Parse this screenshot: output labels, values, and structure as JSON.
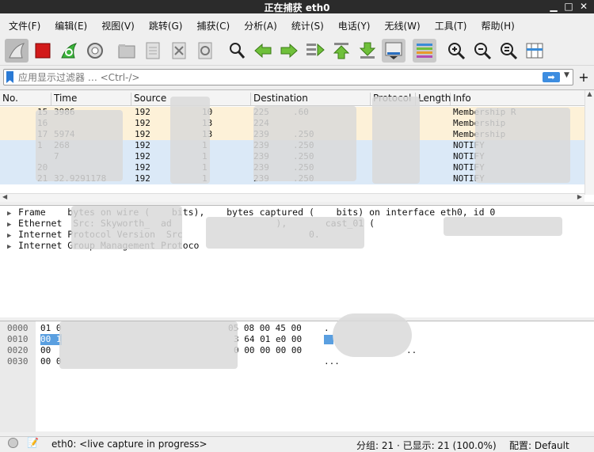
{
  "window": {
    "title": "正在捕获 eth0",
    "min_icon": "minimize-icon",
    "max_icon": "maximize-icon",
    "close_icon": "close-icon"
  },
  "menu": [
    "文件(F)",
    "编辑(E)",
    "视图(V)",
    "跳转(G)",
    "捕获(C)",
    "分析(A)",
    "统计(S)",
    "电话(Y)",
    "无线(W)",
    "工具(T)",
    "帮助(H)"
  ],
  "toolbar": [
    "shark-fin-start-icon",
    "stop-capture-icon",
    "restart-capture-icon",
    "capture-options-icon",
    "open-file-icon",
    "save-file-icon",
    "close-file-icon",
    "reload-file-icon",
    "find-packet-icon",
    "go-back-icon",
    "go-forward-icon",
    "go-to-packet-icon",
    "go-first-icon",
    "go-last-icon",
    "auto-scroll-icon",
    "colorize-icon",
    "zoom-in-icon",
    "zoom-out-icon",
    "normal-size-icon",
    "resize-columns-icon"
  ],
  "filter": {
    "placeholder": "应用显示过滤器 … <Ctrl-/>",
    "add": "+"
  },
  "columns": [
    "No.",
    "Time",
    "Source",
    "Destination",
    "Protocol",
    "Length",
    "Info"
  ],
  "packets": [
    {
      "no": "15",
      "time": "3986",
      "src": "192",
      "srcb": "10",
      "dst": "225",
      "dstb": ".60",
      "info": "Membership R",
      "color": "#fdf1d8"
    },
    {
      "no": "16",
      "time": "",
      "src": "192",
      "srcb": "13",
      "dst": "224",
      "dstb": "",
      "info": "Membership",
      "color": "#fdf1d8"
    },
    {
      "no": "17",
      "time": "5974",
      "src": "192",
      "srcb": "13",
      "dst": "239",
      "dstb": ".250",
      "info": "Membership",
      "color": "#fdf1d8"
    },
    {
      "no": "1",
      "time": "268",
      "src": "192",
      "srcb": "1",
      "dst": "239",
      "dstb": ".250",
      "info": "NOTIFY",
      "color": "#dbe9f7"
    },
    {
      "no": "",
      "time": "7",
      "src": "192",
      "srcb": "1",
      "dst": "239",
      "dstb": ".250",
      "info": "NOTIFY",
      "color": "#dbe9f7"
    },
    {
      "no": "20",
      "time": "",
      "src": "192",
      "srcb": "1",
      "dst": "239",
      "dstb": ".250",
      "info": "NOTIFY",
      "color": "#dbe9f7"
    },
    {
      "no": "21",
      "time": "32.9291178",
      "src": "192",
      "srcb": "1",
      "dst": "239",
      "dstb": ".250",
      "info": "NOTIFY",
      "color": "#dbe9f7"
    }
  ],
  "details": [
    "Frame    bytes on wire (    bits),    bytes captured (    bits) on interface eth0, id 0",
    "Ethernet  Src: Skyworth_  ad                   ),       cast_01 (",
    "Internet Protocol Version  Src                       0.",
    "Internet Group Management Protoco"
  ],
  "bytes": [
    {
      "off": "0000",
      "hex": "01 0",
      "hex2": "05 08 00 45 00",
      "ascii": "."
    },
    {
      "off": "0010",
      "hex": "00 1",
      "hex2": "3 64 01 e0 00",
      "ascii": ""
    },
    {
      "off": "0020",
      "hex": "00",
      "hex2": "0 00 00 00 00",
      "ascii": ".."
    },
    {
      "off": "0030",
      "hex": "00 0",
      "hex2": "",
      "ascii": "..."
    }
  ],
  "status": {
    "capture": "eth0: <live capture in progress>",
    "counts": "分组: 21 · 已显示: 21 (100.0%)",
    "profile": "配置: Default"
  }
}
